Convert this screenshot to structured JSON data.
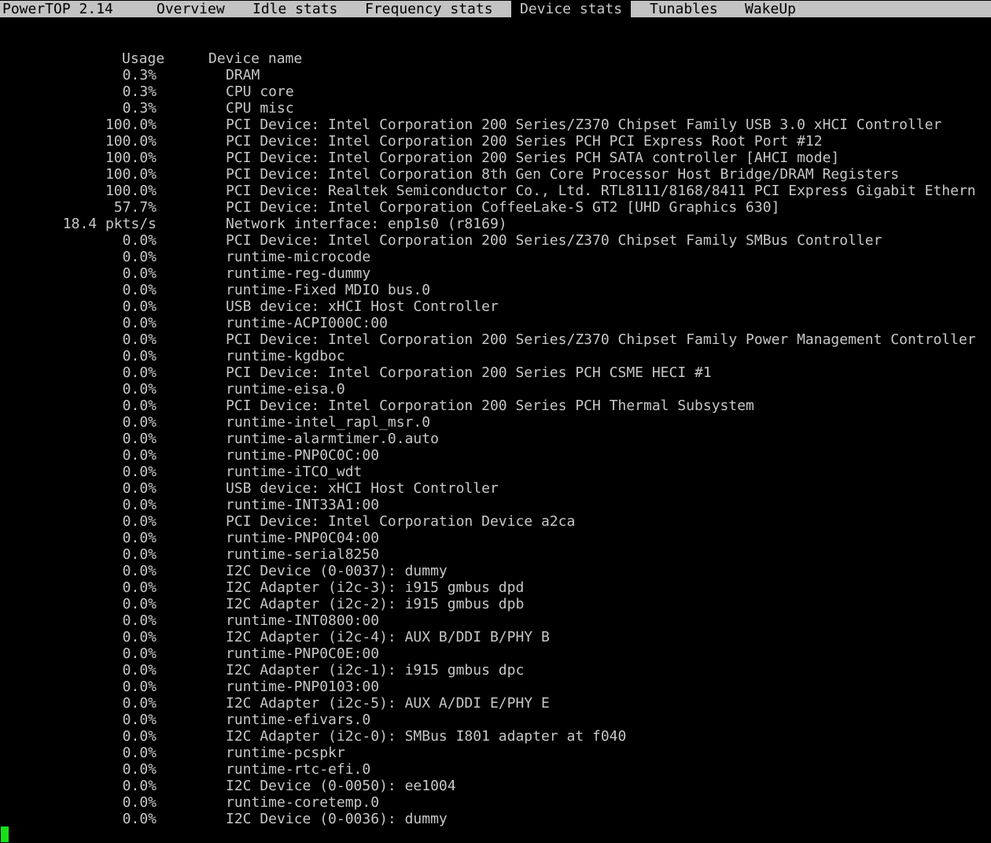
{
  "app_title": "PowerTOP 2.14",
  "tabs": [
    {
      "label": "Overview",
      "active": false
    },
    {
      "label": "Idle stats",
      "active": false
    },
    {
      "label": "Frequency stats",
      "active": false
    },
    {
      "label": "Device stats",
      "active": true
    },
    {
      "label": "Tunables",
      "active": false
    },
    {
      "label": "WakeUp",
      "active": false
    }
  ],
  "table": {
    "columns": [
      "Usage",
      "Device name"
    ],
    "rows": [
      {
        "usage": "0.3%",
        "device": "DRAM"
      },
      {
        "usage": "0.3%",
        "device": "CPU core"
      },
      {
        "usage": "0.3%",
        "device": "CPU misc"
      },
      {
        "usage": "100.0%",
        "device": "PCI Device: Intel Corporation 200 Series/Z370 Chipset Family USB 3.0 xHCI Controller"
      },
      {
        "usage": "100.0%",
        "device": "PCI Device: Intel Corporation 200 Series PCH PCI Express Root Port #12"
      },
      {
        "usage": "100.0%",
        "device": "PCI Device: Intel Corporation 200 Series PCH SATA controller [AHCI mode]"
      },
      {
        "usage": "100.0%",
        "device": "PCI Device: Intel Corporation 8th Gen Core Processor Host Bridge/DRAM Registers"
      },
      {
        "usage": "100.0%",
        "device": "PCI Device: Realtek Semiconductor Co., Ltd. RTL8111/8168/8411 PCI Express Gigabit Ethern"
      },
      {
        "usage": "57.7%",
        "device": "PCI Device: Intel Corporation CoffeeLake-S GT2 [UHD Graphics 630]"
      },
      {
        "usage": "18.4 pkts/s",
        "device": "Network interface: enp1s0 (r8169)"
      },
      {
        "usage": "0.0%",
        "device": "PCI Device: Intel Corporation 200 Series/Z370 Chipset Family SMBus Controller"
      },
      {
        "usage": "0.0%",
        "device": "runtime-microcode"
      },
      {
        "usage": "0.0%",
        "device": "runtime-reg-dummy"
      },
      {
        "usage": "0.0%",
        "device": "runtime-Fixed MDIO bus.0"
      },
      {
        "usage": "0.0%",
        "device": "USB device: xHCI Host Controller"
      },
      {
        "usage": "0.0%",
        "device": "runtime-ACPI000C:00"
      },
      {
        "usage": "0.0%",
        "device": "PCI Device: Intel Corporation 200 Series/Z370 Chipset Family Power Management Controller"
      },
      {
        "usage": "0.0%",
        "device": "runtime-kgdboc"
      },
      {
        "usage": "0.0%",
        "device": "PCI Device: Intel Corporation 200 Series PCH CSME HECI #1"
      },
      {
        "usage": "0.0%",
        "device": "runtime-eisa.0"
      },
      {
        "usage": "0.0%",
        "device": "PCI Device: Intel Corporation 200 Series PCH Thermal Subsystem"
      },
      {
        "usage": "0.0%",
        "device": "runtime-intel_rapl_msr.0"
      },
      {
        "usage": "0.0%",
        "device": "runtime-alarmtimer.0.auto"
      },
      {
        "usage": "0.0%",
        "device": "runtime-PNP0C0C:00"
      },
      {
        "usage": "0.0%",
        "device": "runtime-iTCO_wdt"
      },
      {
        "usage": "0.0%",
        "device": "USB device: xHCI Host Controller"
      },
      {
        "usage": "0.0%",
        "device": "runtime-INT33A1:00"
      },
      {
        "usage": "0.0%",
        "device": "PCI Device: Intel Corporation Device a2ca"
      },
      {
        "usage": "0.0%",
        "device": "runtime-PNP0C04:00"
      },
      {
        "usage": "0.0%",
        "device": "runtime-serial8250"
      },
      {
        "usage": "0.0%",
        "device": "I2C Device (0-0037): dummy"
      },
      {
        "usage": "0.0%",
        "device": "I2C Adapter (i2c-3): i915 gmbus dpd"
      },
      {
        "usage": "0.0%",
        "device": "I2C Adapter (i2c-2): i915 gmbus dpb"
      },
      {
        "usage": "0.0%",
        "device": "runtime-INT0800:00"
      },
      {
        "usage": "0.0%",
        "device": "I2C Adapter (i2c-4): AUX B/DDI B/PHY B"
      },
      {
        "usage": "0.0%",
        "device": "runtime-PNP0C0E:00"
      },
      {
        "usage": "0.0%",
        "device": "I2C Adapter (i2c-1): i915 gmbus dpc"
      },
      {
        "usage": "0.0%",
        "device": "runtime-PNP0103:00"
      },
      {
        "usage": "0.0%",
        "device": "I2C Adapter (i2c-5): AUX A/DDI E/PHY E"
      },
      {
        "usage": "0.0%",
        "device": "runtime-efivars.0"
      },
      {
        "usage": "0.0%",
        "device": "I2C Adapter (i2c-0): SMBus I801 adapter at f040"
      },
      {
        "usage": "0.0%",
        "device": "runtime-pcspkr"
      },
      {
        "usage": "0.0%",
        "device": "runtime-rtc-efi.0"
      },
      {
        "usage": "0.0%",
        "device": "I2C Device (0-0050): ee1004"
      },
      {
        "usage": "0.0%",
        "device": "runtime-coretemp.0"
      },
      {
        "usage": "0.0%",
        "device": "I2C Device (0-0036): dummy"
      }
    ]
  },
  "colors": {
    "background": "#000000",
    "text": "#c7c7c7",
    "tabbar": "#c3c3c3",
    "cursor": "#18e018"
  }
}
